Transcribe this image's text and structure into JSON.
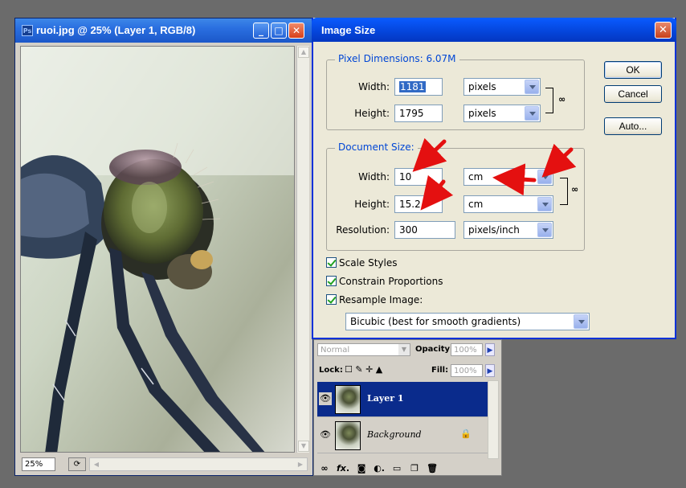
{
  "document_window": {
    "title": "ruoi.jpg @ 25% (Layer 1, RGB/8)",
    "zoom": "25%"
  },
  "layers_panel": {
    "blend_mode": "Normal",
    "opacity_label": "Opacity:",
    "opacity_value": "100%",
    "lock_label": "Lock:",
    "fill_label": "Fill:",
    "fill_value": "100%",
    "layers": [
      {
        "name": "Layer 1",
        "selected": true,
        "visible": true
      },
      {
        "name": "Background",
        "selected": false,
        "visible": true,
        "locked": true
      }
    ]
  },
  "dialog": {
    "title": "Image Size",
    "pixel_dimensions": {
      "legend": "Pixel Dimensions:  6.07M",
      "width_label": "Width:",
      "width_value": "1181",
      "width_unit": "pixels",
      "height_label": "Height:",
      "height_value": "1795",
      "height_unit": "pixels"
    },
    "document_size": {
      "legend": "Document Size:",
      "width_label": "Width:",
      "width_value": "10",
      "width_unit": "cm",
      "height_label": "Height:",
      "height_value": "15.2",
      "height_unit": "cm",
      "resolution_label": "Resolution:",
      "resolution_value": "300",
      "resolution_unit": "pixels/inch"
    },
    "checkboxes": {
      "scale_styles": "Scale Styles",
      "constrain_proportions": "Constrain Proportions",
      "resample_image": "Resample Image:"
    },
    "resample_method": "Bicubic (best for smooth gradients)",
    "buttons": {
      "ok": "OK",
      "cancel": "Cancel",
      "auto": "Auto..."
    }
  },
  "colors": {
    "title_blue": "#0548e0",
    "legend_blue": "#0046d5",
    "annotation_red": "#e41010",
    "selected_layer": "#0a2b8c"
  }
}
